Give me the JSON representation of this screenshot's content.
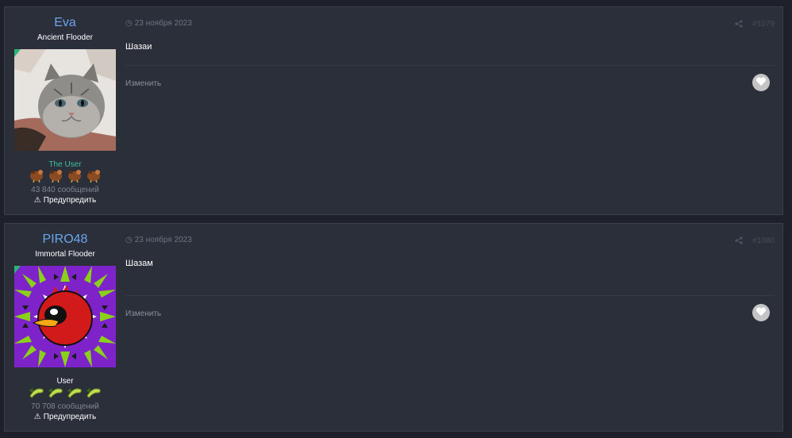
{
  "posts": [
    {
      "author": "Eva",
      "title": "Ancient Flooder",
      "group": "The User",
      "group_color": "#3fbf9a",
      "messages": "43 840 сообщений",
      "warn": "Предупредить",
      "date": "23 ноября 2023",
      "number": "#1079",
      "text": "Шазаи",
      "edit": "Изменить"
    },
    {
      "author": "PIRO48",
      "title": "Immortal Flooder",
      "group": "User",
      "group_color": "#ffffff",
      "messages": "70 708 сообщений",
      "warn": "Предупредить",
      "date": "23 ноября 2023",
      "number": "#1080",
      "text": "Шазам",
      "edit": "Изменить"
    }
  ]
}
